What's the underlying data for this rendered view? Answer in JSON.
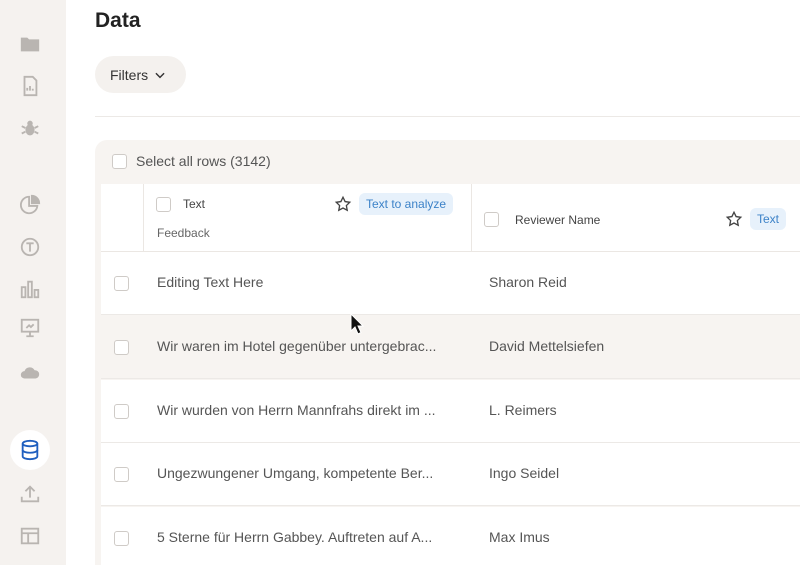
{
  "sidebar": {
    "items": [
      {
        "icon": "folder-icon"
      },
      {
        "icon": "report-icon"
      },
      {
        "icon": "bug-icon"
      },
      {
        "icon": "pie-chart-icon"
      },
      {
        "icon": "text-circle-icon"
      },
      {
        "icon": "bar-chart-icon"
      },
      {
        "icon": "presentation-icon"
      },
      {
        "icon": "cloud-icon"
      },
      {
        "icon": "database-icon",
        "active": true
      },
      {
        "icon": "upload-icon"
      },
      {
        "icon": "layout-icon"
      }
    ],
    "active_color": "#1f5fbf"
  },
  "header": {
    "title": "Data",
    "filters_label": "Filters"
  },
  "table": {
    "select_all_label": "Select all rows (3142)",
    "columns": [
      {
        "label": "Text",
        "sublabel": "Feedback",
        "tag": "Text to analyze"
      },
      {
        "label": "Reviewer Name",
        "tag": "Text"
      }
    ],
    "rows": [
      {
        "text": "Editing Text Here",
        "name": "Sharon Reid"
      },
      {
        "text": "Wir waren im Hotel gegenüber untergebrac...",
        "name": "David Mettelsiefen"
      },
      {
        "text": "Wir wurden von Herrn Mannfrahs direkt im ...",
        "name": "L. Reimers"
      },
      {
        "text": "Ungezwungener Umgang, kompetente Ber...",
        "name": "Ingo Seidel"
      },
      {
        "text": "5 Sterne für Herrn Gabbey. Auftreten auf A...",
        "name": "Max Imus"
      }
    ]
  },
  "colors": {
    "tag_bg": "#e7f1fb",
    "tag_text": "#3c82c8",
    "sidebar_bg": "#f5f2ef"
  }
}
